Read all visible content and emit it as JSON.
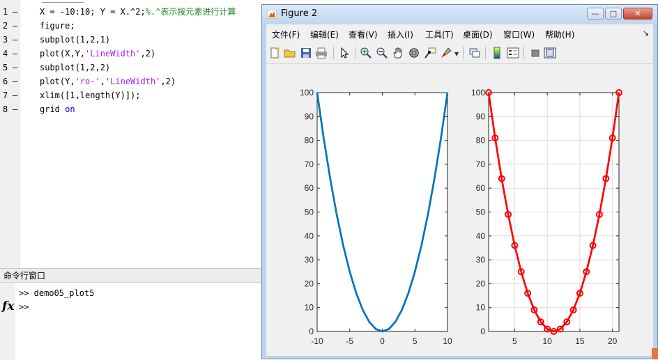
{
  "editor": {
    "lines": [
      {
        "num": "1",
        "parts": [
          {
            "t": "X = -10:10; Y = X.^2;",
            "c": ""
          },
          {
            "t": "%.^表示按元素进行计算",
            "c": "cmt"
          }
        ]
      },
      {
        "num": "2",
        "parts": [
          {
            "t": "figure;",
            "c": ""
          }
        ]
      },
      {
        "num": "3",
        "parts": [
          {
            "t": "subplot(1,2,1)",
            "c": ""
          }
        ]
      },
      {
        "num": "4",
        "parts": [
          {
            "t": "plot(X,Y,",
            "c": ""
          },
          {
            "t": "'LineWidth'",
            "c": "str"
          },
          {
            "t": ",2)",
            "c": ""
          }
        ]
      },
      {
        "num": "5",
        "parts": [
          {
            "t": "subplot(1,2,2)",
            "c": ""
          }
        ]
      },
      {
        "num": "6",
        "parts": [
          {
            "t": "plot(Y,",
            "c": ""
          },
          {
            "t": "'ro-'",
            "c": "str"
          },
          {
            "t": ",",
            "c": ""
          },
          {
            "t": "'LineWidth'",
            "c": "str"
          },
          {
            "t": ",2)",
            "c": ""
          }
        ]
      },
      {
        "num": "7",
        "parts": [
          {
            "t": "xlim([1,length(Y)]);",
            "c": ""
          }
        ]
      },
      {
        "num": "8",
        "parts": [
          {
            "t": "grid ",
            "c": ""
          },
          {
            "t": "on",
            "c": "kw"
          }
        ]
      }
    ]
  },
  "command_window": {
    "title": "命令行窗口",
    "line1": ">> demo05_plot5",
    "line2": ">>",
    "fx_label": "fx"
  },
  "figure_window": {
    "title": "Figure 2",
    "minimize_label": "—",
    "maximize_label": "□",
    "close_label": "✕",
    "menu": [
      "文件(F)",
      "编辑(E)",
      "查看(V)",
      "插入(I)",
      "工具(T)",
      "桌面(D)",
      "窗口(W)",
      "帮助(H)"
    ],
    "menu_overflow": "↘",
    "toolbar_icons": [
      "new-file-icon",
      "open-file-icon",
      "save-icon",
      "print-icon",
      "select-arrow-icon",
      "zoom-in-icon",
      "zoom-out-icon",
      "pan-hand-icon",
      "rotate-3d-icon",
      "data-cursor-icon",
      "brush-icon",
      "link-plot-icon",
      "colorbar-icon",
      "legend-icon",
      "hide-plot-tools-icon",
      "show-plot-tools-icon"
    ]
  },
  "chart_data": [
    {
      "type": "line",
      "x": [
        -10,
        -9,
        -8,
        -7,
        -6,
        -5,
        -4,
        -3,
        -2,
        -1,
        0,
        1,
        2,
        3,
        4,
        5,
        6,
        7,
        8,
        9,
        10
      ],
      "series": [
        {
          "values": [
            100,
            81,
            64,
            49,
            36,
            25,
            16,
            9,
            4,
            1,
            0,
            1,
            4,
            9,
            16,
            25,
            36,
            49,
            64,
            81,
            100
          ],
          "color": "#0072bd",
          "line_width": 2,
          "marker": "none"
        }
      ],
      "xlim": [
        -10,
        10
      ],
      "ylim": [
        0,
        100
      ],
      "xticks": [
        -10,
        -5,
        0,
        5,
        10
      ],
      "yticks": [
        0,
        10,
        20,
        30,
        40,
        50,
        60,
        70,
        80,
        90,
        100
      ],
      "grid": false
    },
    {
      "type": "line",
      "x": [
        1,
        2,
        3,
        4,
        5,
        6,
        7,
        8,
        9,
        10,
        11,
        12,
        13,
        14,
        15,
        16,
        17,
        18,
        19,
        20,
        21
      ],
      "series": [
        {
          "values": [
            100,
            81,
            64,
            49,
            36,
            25,
            16,
            9,
            4,
            1,
            0,
            1,
            4,
            9,
            16,
            25,
            36,
            49,
            64,
            81,
            100
          ],
          "color": "#ff0000",
          "line_width": 2,
          "marker": "circle"
        }
      ],
      "xlim": [
        1,
        21
      ],
      "ylim": [
        0,
        100
      ],
      "xticks": [
        5,
        10,
        15,
        20
      ],
      "yticks": [
        0,
        10,
        20,
        30,
        40,
        50,
        60,
        70,
        80,
        90,
        100
      ],
      "grid": true
    }
  ]
}
